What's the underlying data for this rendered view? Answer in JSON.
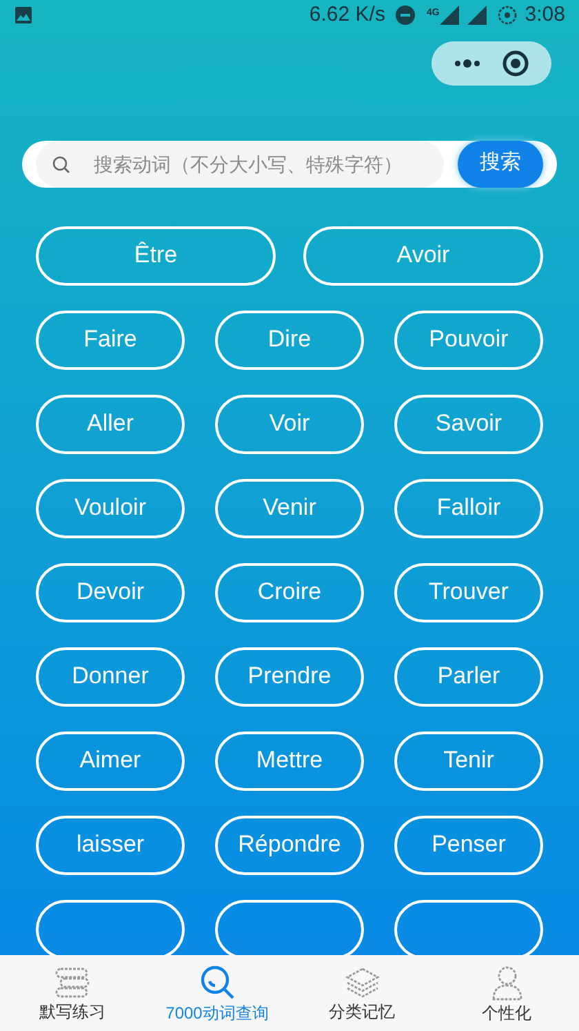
{
  "status_bar": {
    "speed": "6.62 K/s",
    "network": "4G",
    "time": "3:08"
  },
  "search": {
    "placeholder": "搜索动词（不分大小写、特殊字符）",
    "button": "搜索"
  },
  "featured_verbs": [
    "Être",
    "Avoir"
  ],
  "verbs": [
    "Faire",
    "Dire",
    "Pouvoir",
    "Aller",
    "Voir",
    "Savoir",
    "Vouloir",
    "Venir",
    "Falloir",
    "Devoir",
    "Croire",
    "Trouver",
    "Donner",
    "Prendre",
    "Parler",
    "Aimer",
    "Mettre",
    "Tenir",
    "laisser",
    "Répondre",
    "Penser"
  ],
  "tabs": [
    {
      "kind": "books",
      "label": "默写练习",
      "selected": false
    },
    {
      "kind": "search",
      "label": "7000动词查询",
      "selected": true
    },
    {
      "kind": "layers",
      "label": "分类记忆",
      "selected": false
    },
    {
      "kind": "person",
      "label": "个性化",
      "selected": false
    }
  ]
}
